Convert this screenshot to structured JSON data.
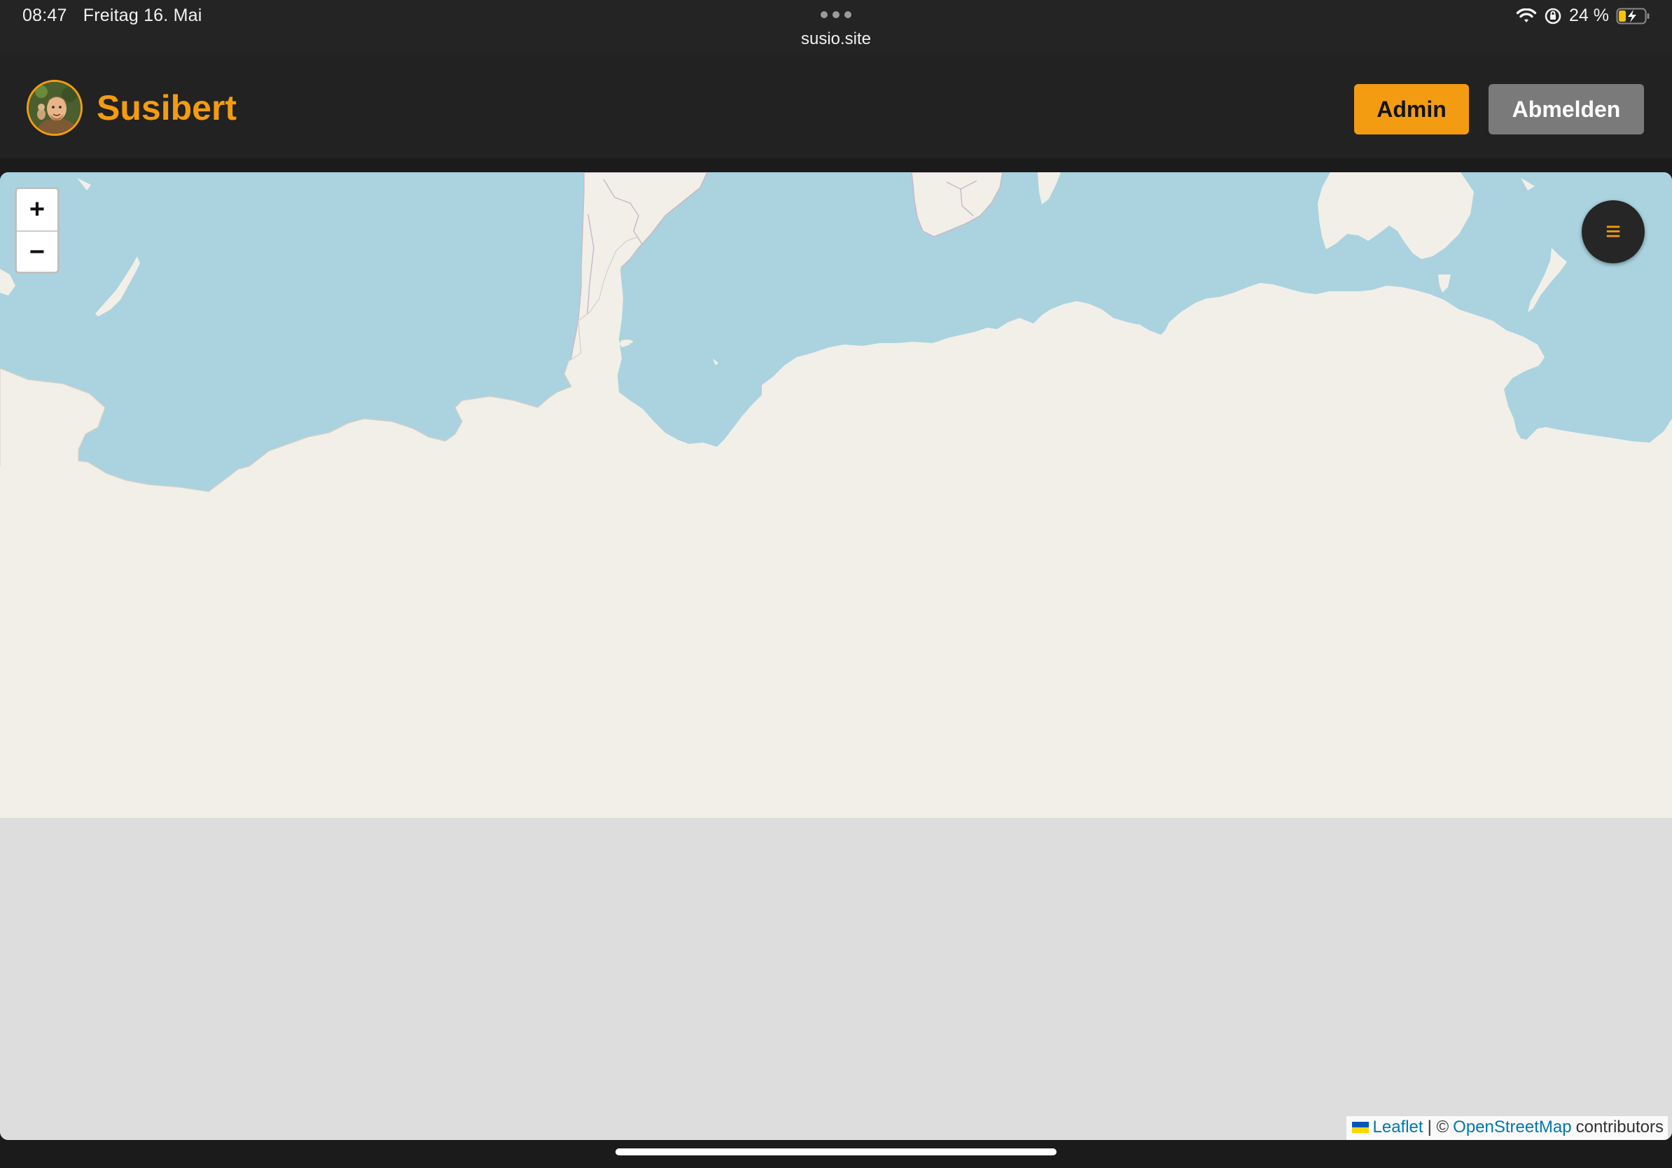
{
  "status_bar": {
    "time": "08:47",
    "date": "Freitag 16. Mai",
    "url": "susio.site",
    "battery": "24 %"
  },
  "header": {
    "brand_name": "Susibert",
    "admin_label": "Admin",
    "logout_label": "Abmelden"
  },
  "map": {
    "zoom_in_label": "+",
    "zoom_out_label": "−",
    "menu_icon": "≡",
    "attribution": {
      "leaflet": "Leaflet",
      "separator": "| ©",
      "osm": "OpenStreetMap",
      "suffix": "contributors"
    },
    "colors": {
      "water": "#aad3df",
      "land": "#f2efe9",
      "no_tiles": "#dddddd",
      "accent": "#f39c12"
    }
  }
}
